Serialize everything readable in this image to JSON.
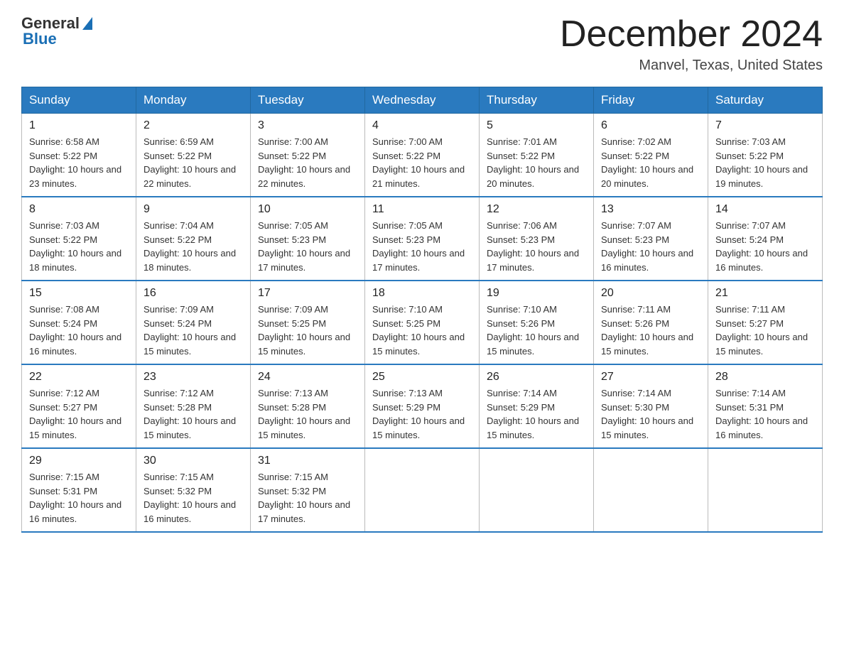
{
  "header": {
    "logo_general": "General",
    "logo_blue": "Blue",
    "month_title": "December 2024",
    "location": "Manvel, Texas, United States"
  },
  "weekdays": [
    "Sunday",
    "Monday",
    "Tuesday",
    "Wednesday",
    "Thursday",
    "Friday",
    "Saturday"
  ],
  "weeks": [
    [
      {
        "day": "1",
        "sunrise": "6:58 AM",
        "sunset": "5:22 PM",
        "daylight": "10 hours and 23 minutes."
      },
      {
        "day": "2",
        "sunrise": "6:59 AM",
        "sunset": "5:22 PM",
        "daylight": "10 hours and 22 minutes."
      },
      {
        "day": "3",
        "sunrise": "7:00 AM",
        "sunset": "5:22 PM",
        "daylight": "10 hours and 22 minutes."
      },
      {
        "day": "4",
        "sunrise": "7:00 AM",
        "sunset": "5:22 PM",
        "daylight": "10 hours and 21 minutes."
      },
      {
        "day": "5",
        "sunrise": "7:01 AM",
        "sunset": "5:22 PM",
        "daylight": "10 hours and 20 minutes."
      },
      {
        "day": "6",
        "sunrise": "7:02 AM",
        "sunset": "5:22 PM",
        "daylight": "10 hours and 20 minutes."
      },
      {
        "day": "7",
        "sunrise": "7:03 AM",
        "sunset": "5:22 PM",
        "daylight": "10 hours and 19 minutes."
      }
    ],
    [
      {
        "day": "8",
        "sunrise": "7:03 AM",
        "sunset": "5:22 PM",
        "daylight": "10 hours and 18 minutes."
      },
      {
        "day": "9",
        "sunrise": "7:04 AM",
        "sunset": "5:22 PM",
        "daylight": "10 hours and 18 minutes."
      },
      {
        "day": "10",
        "sunrise": "7:05 AM",
        "sunset": "5:23 PM",
        "daylight": "10 hours and 17 minutes."
      },
      {
        "day": "11",
        "sunrise": "7:05 AM",
        "sunset": "5:23 PM",
        "daylight": "10 hours and 17 minutes."
      },
      {
        "day": "12",
        "sunrise": "7:06 AM",
        "sunset": "5:23 PM",
        "daylight": "10 hours and 17 minutes."
      },
      {
        "day": "13",
        "sunrise": "7:07 AM",
        "sunset": "5:23 PM",
        "daylight": "10 hours and 16 minutes."
      },
      {
        "day": "14",
        "sunrise": "7:07 AM",
        "sunset": "5:24 PM",
        "daylight": "10 hours and 16 minutes."
      }
    ],
    [
      {
        "day": "15",
        "sunrise": "7:08 AM",
        "sunset": "5:24 PM",
        "daylight": "10 hours and 16 minutes."
      },
      {
        "day": "16",
        "sunrise": "7:09 AM",
        "sunset": "5:24 PM",
        "daylight": "10 hours and 15 minutes."
      },
      {
        "day": "17",
        "sunrise": "7:09 AM",
        "sunset": "5:25 PM",
        "daylight": "10 hours and 15 minutes."
      },
      {
        "day": "18",
        "sunrise": "7:10 AM",
        "sunset": "5:25 PM",
        "daylight": "10 hours and 15 minutes."
      },
      {
        "day": "19",
        "sunrise": "7:10 AM",
        "sunset": "5:26 PM",
        "daylight": "10 hours and 15 minutes."
      },
      {
        "day": "20",
        "sunrise": "7:11 AM",
        "sunset": "5:26 PM",
        "daylight": "10 hours and 15 minutes."
      },
      {
        "day": "21",
        "sunrise": "7:11 AM",
        "sunset": "5:27 PM",
        "daylight": "10 hours and 15 minutes."
      }
    ],
    [
      {
        "day": "22",
        "sunrise": "7:12 AM",
        "sunset": "5:27 PM",
        "daylight": "10 hours and 15 minutes."
      },
      {
        "day": "23",
        "sunrise": "7:12 AM",
        "sunset": "5:28 PM",
        "daylight": "10 hours and 15 minutes."
      },
      {
        "day": "24",
        "sunrise": "7:13 AM",
        "sunset": "5:28 PM",
        "daylight": "10 hours and 15 minutes."
      },
      {
        "day": "25",
        "sunrise": "7:13 AM",
        "sunset": "5:29 PM",
        "daylight": "10 hours and 15 minutes."
      },
      {
        "day": "26",
        "sunrise": "7:14 AM",
        "sunset": "5:29 PM",
        "daylight": "10 hours and 15 minutes."
      },
      {
        "day": "27",
        "sunrise": "7:14 AM",
        "sunset": "5:30 PM",
        "daylight": "10 hours and 15 minutes."
      },
      {
        "day": "28",
        "sunrise": "7:14 AM",
        "sunset": "5:31 PM",
        "daylight": "10 hours and 16 minutes."
      }
    ],
    [
      {
        "day": "29",
        "sunrise": "7:15 AM",
        "sunset": "5:31 PM",
        "daylight": "10 hours and 16 minutes."
      },
      {
        "day": "30",
        "sunrise": "7:15 AM",
        "sunset": "5:32 PM",
        "daylight": "10 hours and 16 minutes."
      },
      {
        "day": "31",
        "sunrise": "7:15 AM",
        "sunset": "5:32 PM",
        "daylight": "10 hours and 17 minutes."
      },
      null,
      null,
      null,
      null
    ]
  ]
}
